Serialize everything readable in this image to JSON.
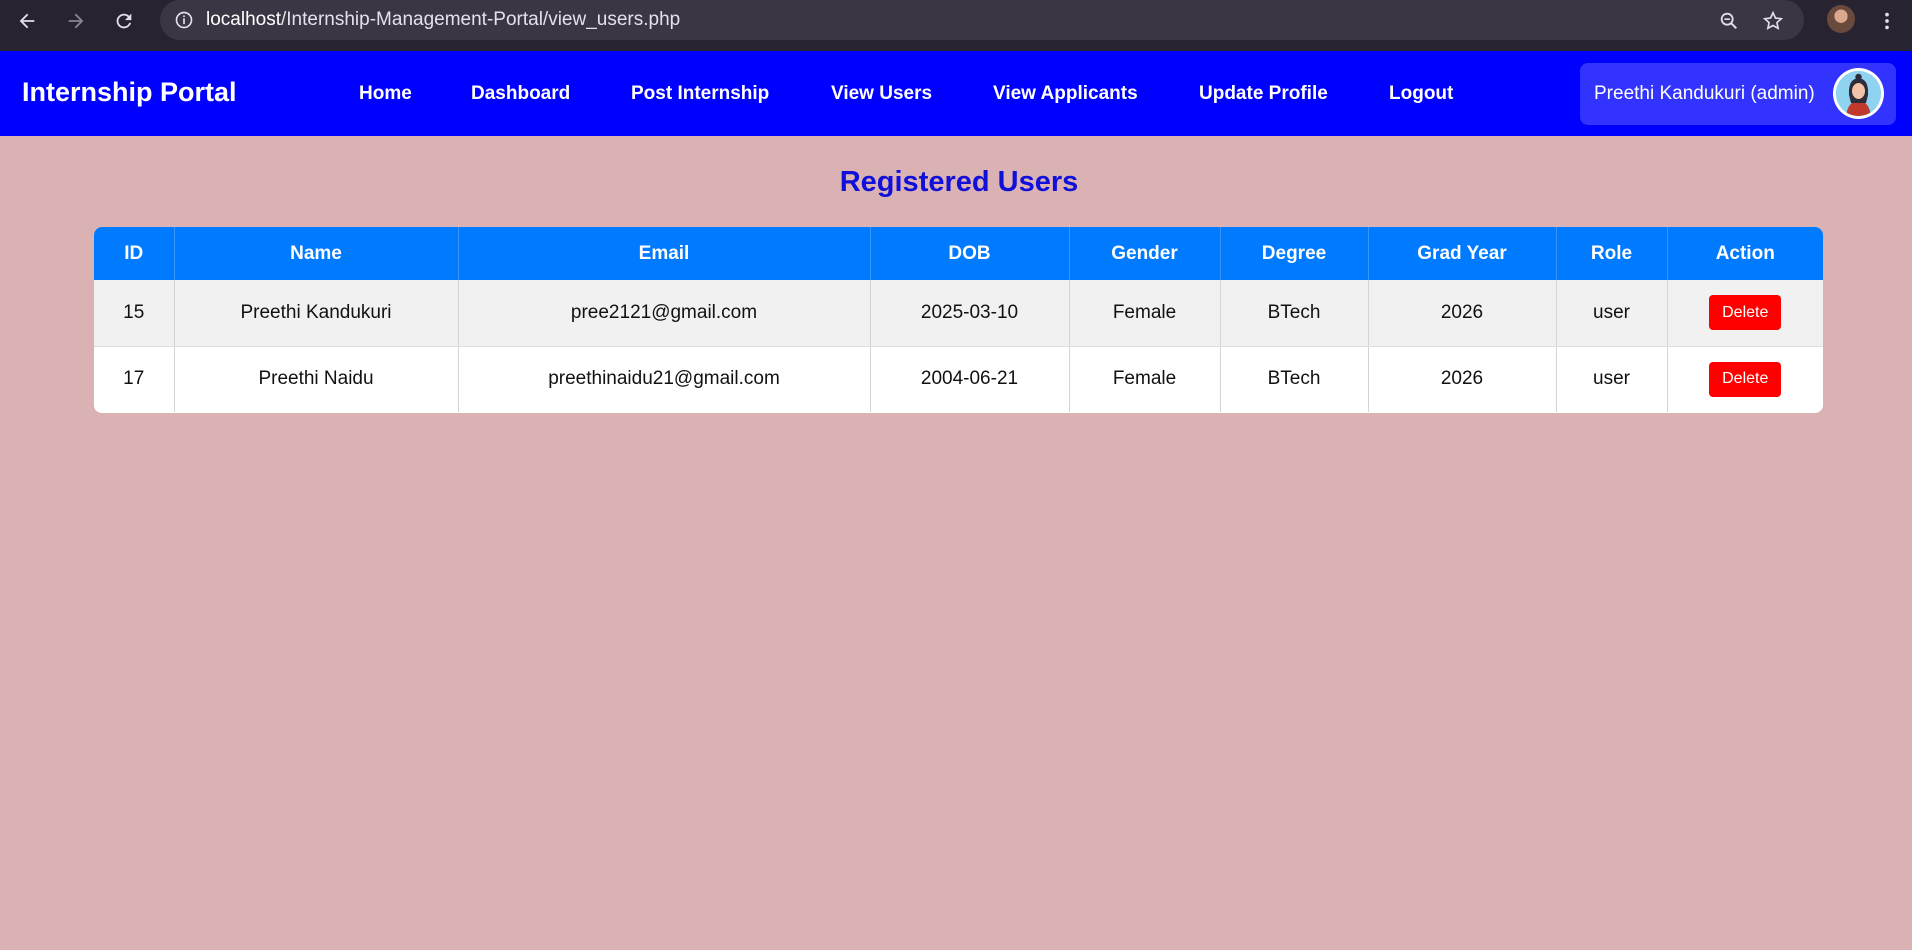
{
  "browser": {
    "url_host": "localhost",
    "url_path": "/Internship-Management-Portal/view_users.php"
  },
  "header": {
    "brand": "Internship Portal",
    "nav": [
      {
        "label": "Home"
      },
      {
        "label": "Dashboard"
      },
      {
        "label": "Post Internship"
      },
      {
        "label": "View Users"
      },
      {
        "label": "View Applicants"
      },
      {
        "label": "Update Profile"
      },
      {
        "label": "Logout"
      }
    ],
    "user_label": "Preethi Kandukuri (admin)"
  },
  "main": {
    "title": "Registered Users",
    "columns": [
      "ID",
      "Name",
      "Email",
      "DOB",
      "Gender",
      "Degree",
      "Grad Year",
      "Role",
      "Action"
    ],
    "rows": [
      {
        "id": "15",
        "name": "Preethi Kandukuri",
        "email": "pree2121@gmail.com",
        "dob": "2025-03-10",
        "gender": "Female",
        "degree": "BTech",
        "grad_year": "2026",
        "role": "user",
        "action": "Delete"
      },
      {
        "id": "17",
        "name": "Preethi Naidu",
        "email": "preethinaidu21@gmail.com",
        "dob": "2004-06-21",
        "gender": "Female",
        "degree": "BTech",
        "grad_year": "2026",
        "role": "user",
        "action": "Delete"
      }
    ]
  },
  "colors": {
    "page_background": "#dbb2b4",
    "header_background": "#0000ff",
    "table_header": "#007bff",
    "delete_button": "#ff0000",
    "title_color": "#1010d9"
  },
  "icons": [
    "back-arrow-icon",
    "forward-arrow-icon",
    "reload-icon",
    "site-info-icon",
    "zoom-icon",
    "bookmark-star-icon",
    "browser-menu-icon"
  ]
}
